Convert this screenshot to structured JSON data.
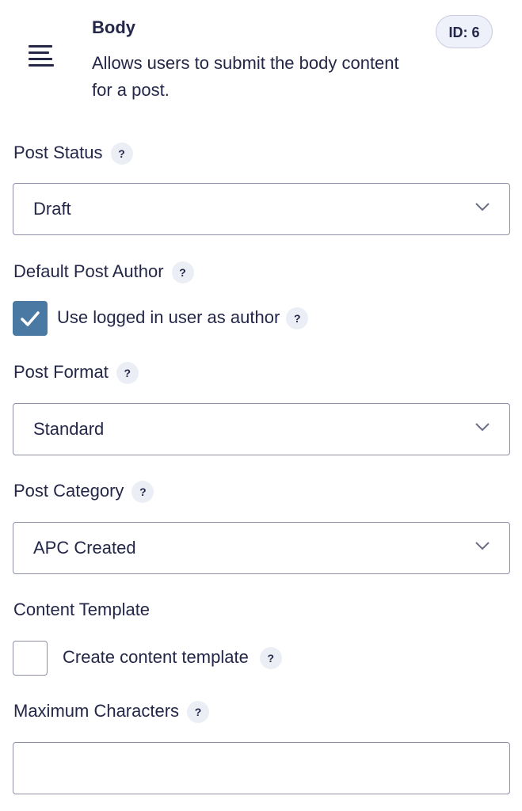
{
  "field": {
    "title": "Body",
    "description": "Allows users to submit the body content for a post.",
    "id_badge": "ID: 6",
    "icon": "align-justify-icon"
  },
  "help_glyph": "?",
  "post_status": {
    "label": "Post Status",
    "value": "Draft"
  },
  "default_author": {
    "label": "Default Post Author",
    "checkbox_label": "Use logged in user as author",
    "checked": true
  },
  "post_format": {
    "label": "Post Format",
    "value": "Standard"
  },
  "post_category": {
    "label": "Post Category",
    "value": "APC Created"
  },
  "content_template": {
    "label": "Content Template",
    "checkbox_label": "Create content template",
    "checked": false
  },
  "max_chars": {
    "label": "Maximum Characters",
    "value": ""
  },
  "colors": {
    "text": "#242748",
    "accent": "#4a7aa3",
    "border": "#8e90a8",
    "help_bg": "#eceef6"
  }
}
